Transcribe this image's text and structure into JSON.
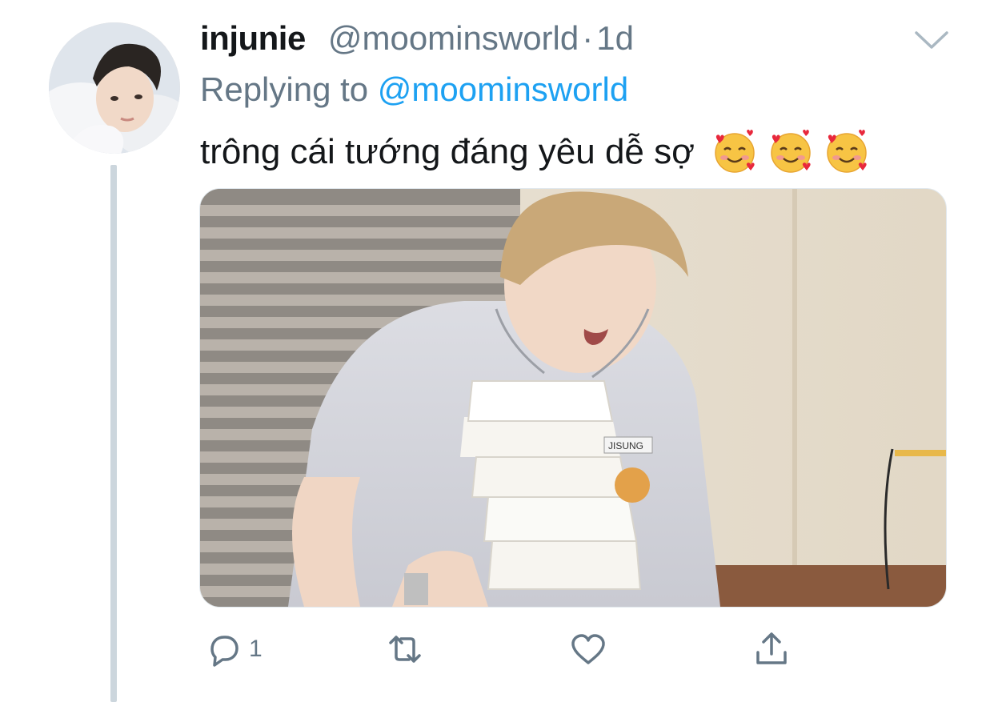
{
  "tweet": {
    "display_name": "injunie",
    "handle": "@moominsworld",
    "separator": "·",
    "time": "1d",
    "replying_prefix": "Replying to",
    "replying_to": "@moominsworld",
    "text": "trông cái tướng đáng yêu dễ sợ",
    "emojis": [
      "smiling-face-with-hearts",
      "smiling-face-with-hearts",
      "smiling-face-with-hearts"
    ],
    "media_label": "JISUNG"
  },
  "actions": {
    "reply_count": "1",
    "retweet_count": "",
    "like_count": ""
  },
  "colors": {
    "text_primary": "#14171a",
    "text_secondary": "#657786",
    "link": "#1da1f2",
    "thread_line": "#ccd6dd"
  }
}
